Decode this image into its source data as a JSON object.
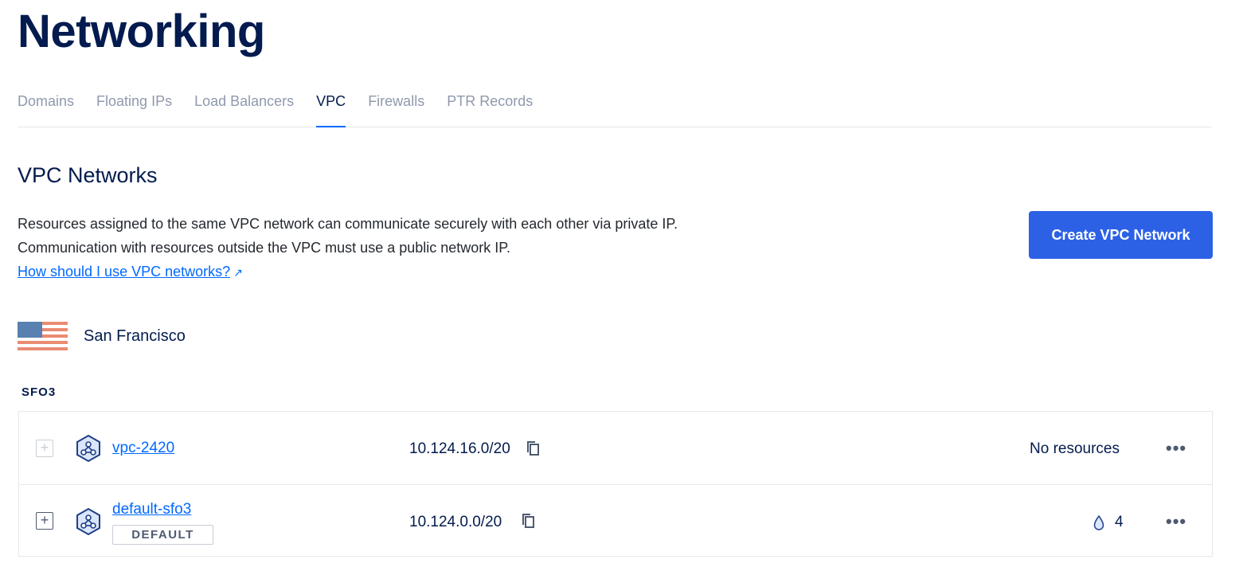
{
  "page": {
    "title": "Networking"
  },
  "tabs": [
    {
      "label": "Domains"
    },
    {
      "label": "Floating IPs"
    },
    {
      "label": "Load Balancers"
    },
    {
      "label": "VPC",
      "active": true
    },
    {
      "label": "Firewalls"
    },
    {
      "label": "PTR Records"
    }
  ],
  "section": {
    "title": "VPC Networks",
    "description_line1": "Resources assigned to the same VPC network can communicate securely with each other via private IP.",
    "description_line2": "Communication with resources outside the VPC must use a public network IP.",
    "help_link": "How should I use VPC networks?",
    "create_button": "Create VPC Network"
  },
  "region": {
    "name": "San Francisco",
    "flag_icon": "us-flag-icon",
    "datacenter": "SFO3"
  },
  "vpcs": [
    {
      "name": "vpc-2420",
      "ip_range": "10.124.16.0/20",
      "resources": "No resources",
      "is_default": false
    },
    {
      "name": "default-sfo3",
      "badge": "DEFAULT",
      "ip_range": "10.124.0.0/20",
      "droplet_count": "4",
      "is_default": true
    }
  ],
  "icons": {
    "expand": "+",
    "more": "•••",
    "link_arrow": "↗"
  },
  "colors": {
    "primary": "#0069ff",
    "button": "#2c61e6",
    "text": "#031b4e",
    "muted": "#8f99ad"
  }
}
